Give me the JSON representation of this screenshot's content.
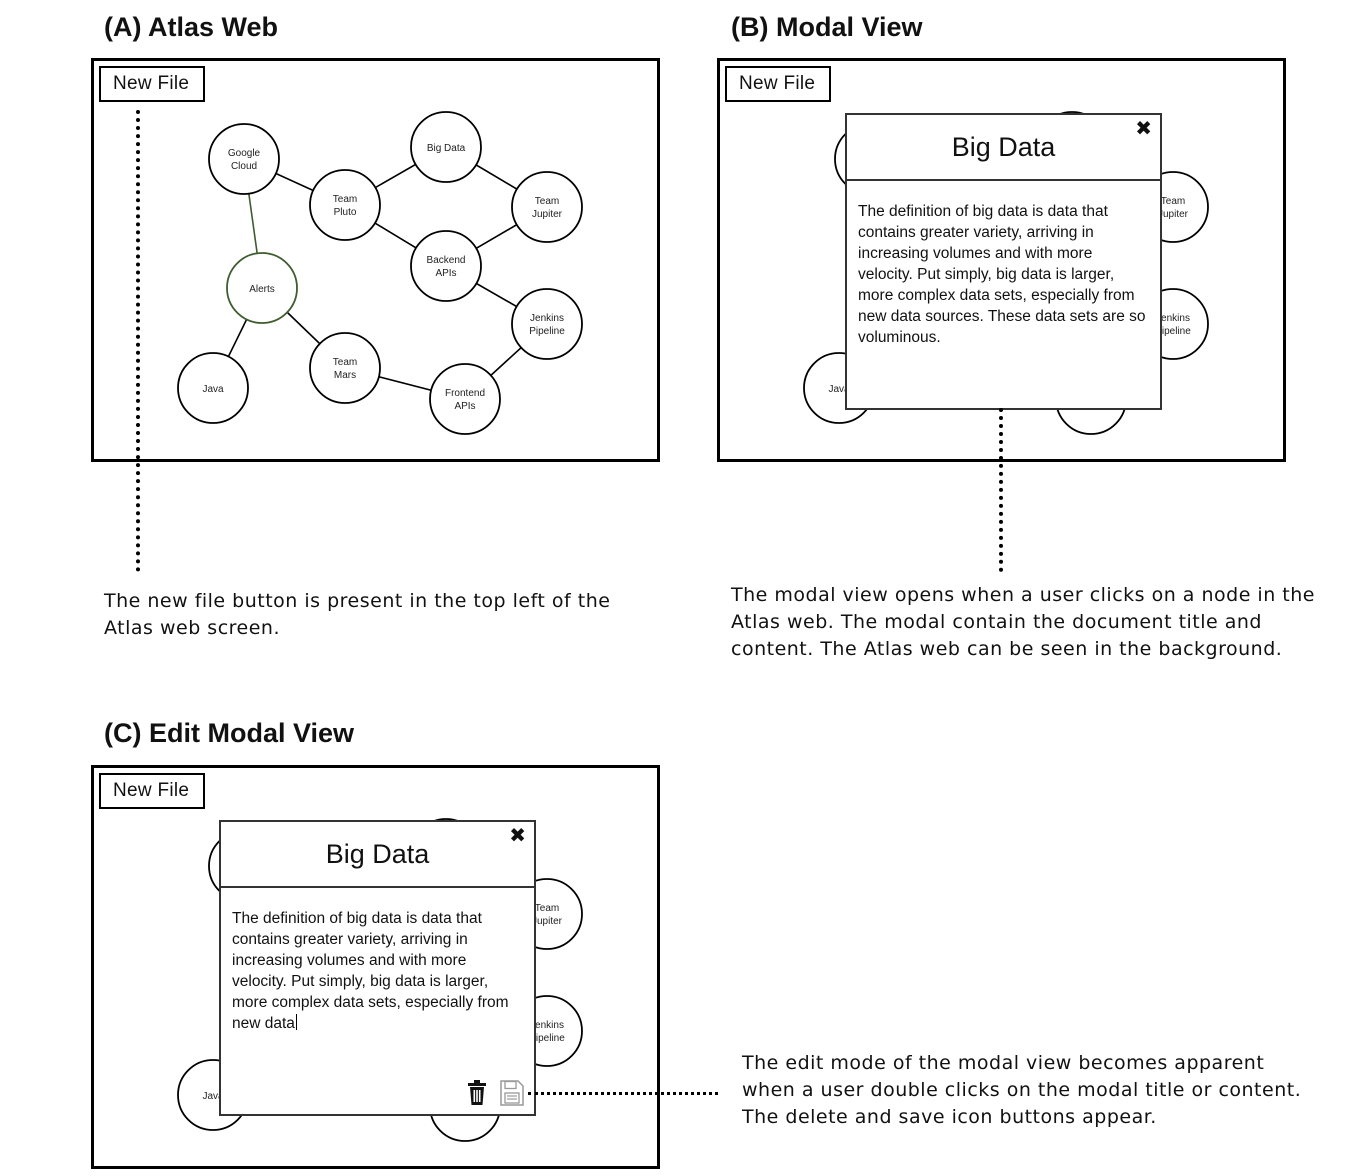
{
  "panels": {
    "a": {
      "title": "(A) Atlas Web",
      "caption": "The new file button is present in the top left of the Atlas web screen."
    },
    "b": {
      "title": "(B) Modal View",
      "caption": "The modal view opens when a user clicks on a node in the Atlas web. The modal contain the document title and content. The Atlas web can be seen in the background."
    },
    "c": {
      "title": "(C) Edit Modal View",
      "caption": "The edit mode of the modal view becomes apparent when a user double clicks on the modal title or content. The delete and save icon buttons appear."
    }
  },
  "new_file_label": "New File",
  "nodes": {
    "google_cloud": [
      "Google",
      "Cloud"
    ],
    "big_data": [
      "Big Data"
    ],
    "team_pluto": [
      "Team",
      "Pluto"
    ],
    "team_jupiter": [
      "Team",
      "Jupiter"
    ],
    "backend_apis": [
      "Backend",
      "APIs"
    ],
    "alerts": [
      "Alerts"
    ],
    "jenkins_pipeline": [
      "Jenkins",
      "Pipeline"
    ],
    "team_mars": [
      "Team",
      "Mars"
    ],
    "java": [
      "Java"
    ],
    "frontend_apis": [
      "Frontend",
      "APIs"
    ]
  },
  "modal_b": {
    "title": "Big Data",
    "close_icon": "✖",
    "content": "The definition of big data is data that contains greater variety, arriving in increasing volumes and with more velocity. Put simply, big data is larger, more complex data sets, especially from new data sources. These data sets are so voluminous."
  },
  "modal_c": {
    "title": "Big Data",
    "close_icon": "✖",
    "content": "The definition of big data is data that contains greater variety, arriving in increasing volumes and with more velocity. Put simply, big data is larger, more complex data sets, especially from new data",
    "icons": [
      "trash-icon",
      "save-icon"
    ]
  },
  "colors": {
    "alerts_border": "#3f5c2f"
  }
}
